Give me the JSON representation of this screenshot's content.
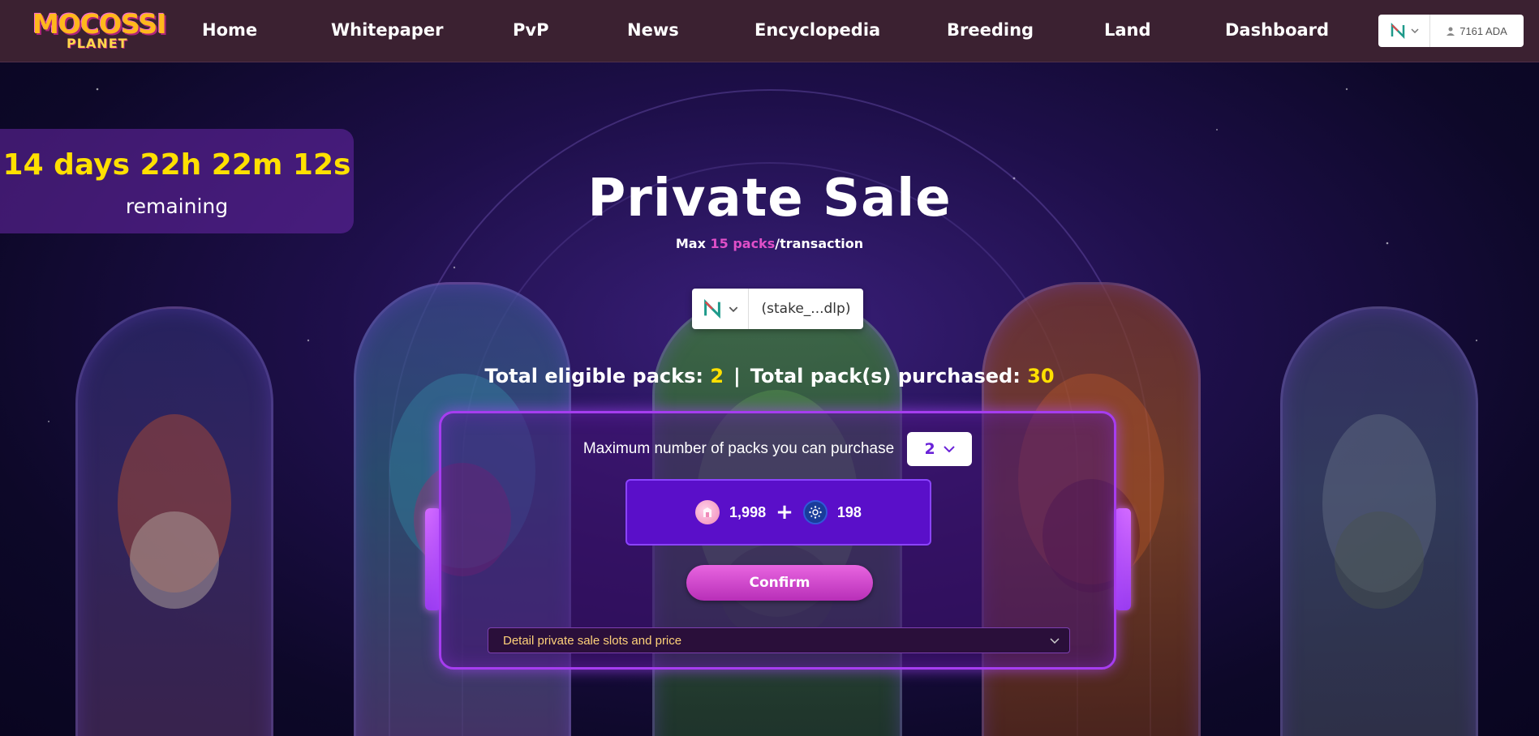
{
  "brand": {
    "logo_text": "MOCOSSI",
    "logo_sub": "PLANET",
    "colors": {
      "nav_bg": "#3b2131",
      "accent_yellow": "#ffe000",
      "accent_pink": "#e04fc8",
      "panel_border": "#a63df0",
      "button": "#d14ad3"
    }
  },
  "nav": {
    "items": [
      {
        "label": "Home"
      },
      {
        "label": "Whitepaper"
      },
      {
        "label": "PvP"
      },
      {
        "label": "News"
      },
      {
        "label": "Encyclopedia"
      },
      {
        "label": "Breeding"
      },
      {
        "label": "Land"
      },
      {
        "label": "Dashboard"
      }
    ],
    "wallet": {
      "icon": "nami-wallet-icon",
      "balance": "7161 ADA"
    }
  },
  "countdown": {
    "time": "14 days 22h 22m 12s",
    "label": "remaining"
  },
  "sale": {
    "title": "Private Sale",
    "subtitle_prefix": "Max ",
    "subtitle_highlight": "15 packs",
    "subtitle_suffix": "/transaction",
    "wallet_address": "(stake_...dlp)",
    "eligible_label": "Total eligible packs: ",
    "eligible_value": "2",
    "separator": "|",
    "purchased_label": "Total pack(s) purchased: ",
    "purchased_value": "30"
  },
  "panel": {
    "max_label": "Maximum number of packs you can purchase",
    "max_value": "2",
    "token_price": "1,998",
    "plus": "+",
    "ada_price": "198",
    "confirm_label": "Confirm",
    "details_label": "Detail private sale slots and price"
  }
}
